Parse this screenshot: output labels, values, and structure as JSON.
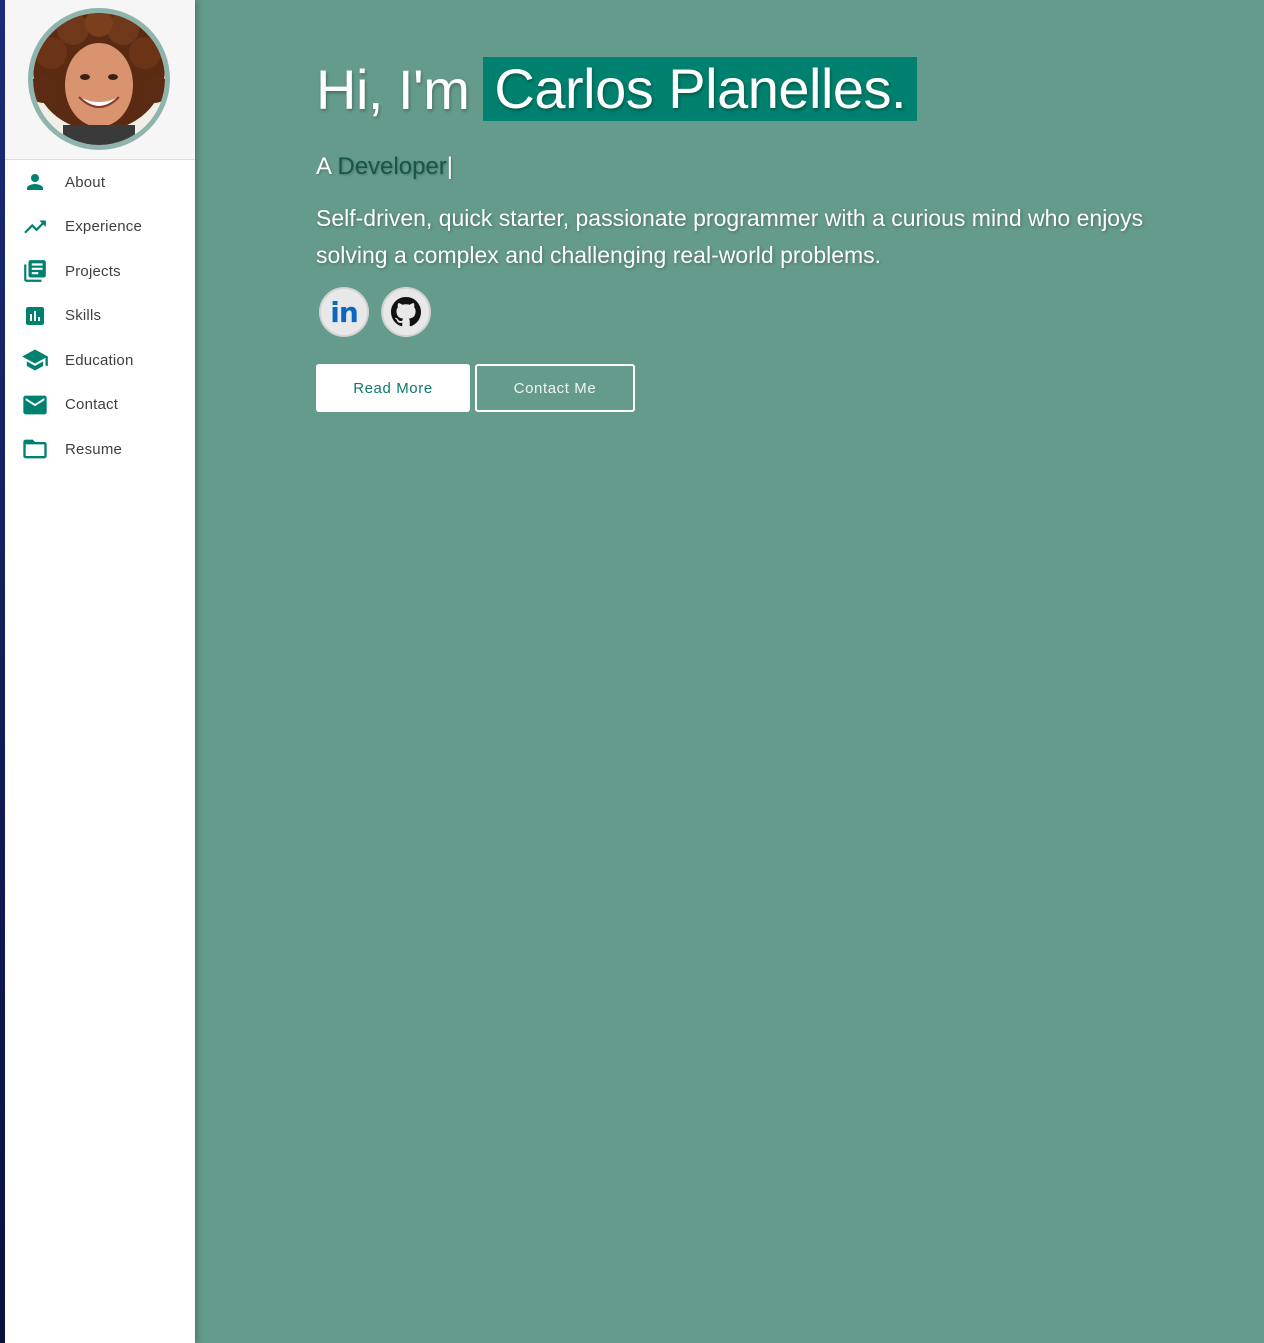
{
  "colors": {
    "accent": "#00806e",
    "background": "#659b8c",
    "sidebar": "#ffffff",
    "icon": "#00806e"
  },
  "profile": {
    "avatar_alt": "profile photo"
  },
  "sidebar": {
    "items": [
      {
        "label": "About",
        "icon": "person-icon"
      },
      {
        "label": "Experience",
        "icon": "trending-up-icon"
      },
      {
        "label": "Projects",
        "icon": "library-books-icon"
      },
      {
        "label": "Skills",
        "icon": "bar-chart-icon"
      },
      {
        "label": "Education",
        "icon": "school-icon"
      },
      {
        "label": "Contact",
        "icon": "mail-icon"
      },
      {
        "label": "Resume",
        "icon": "folder-icon"
      }
    ]
  },
  "hero": {
    "greeting": "Hi, I'm",
    "name": "Carlos Planelles.",
    "subtitle_prefix": "A",
    "role": "Developer",
    "caret": "|",
    "bio": "Self-driven, quick starter, passionate programmer with a curious mind who enjoys solving a complex and challenging real-world problems."
  },
  "socials": {
    "linkedin_text": "in",
    "linkedin_icon": "linkedin-icon",
    "github_icon": "github-icon"
  },
  "buttons": {
    "read_more": "Read More",
    "contact_me": "Contact Me"
  }
}
